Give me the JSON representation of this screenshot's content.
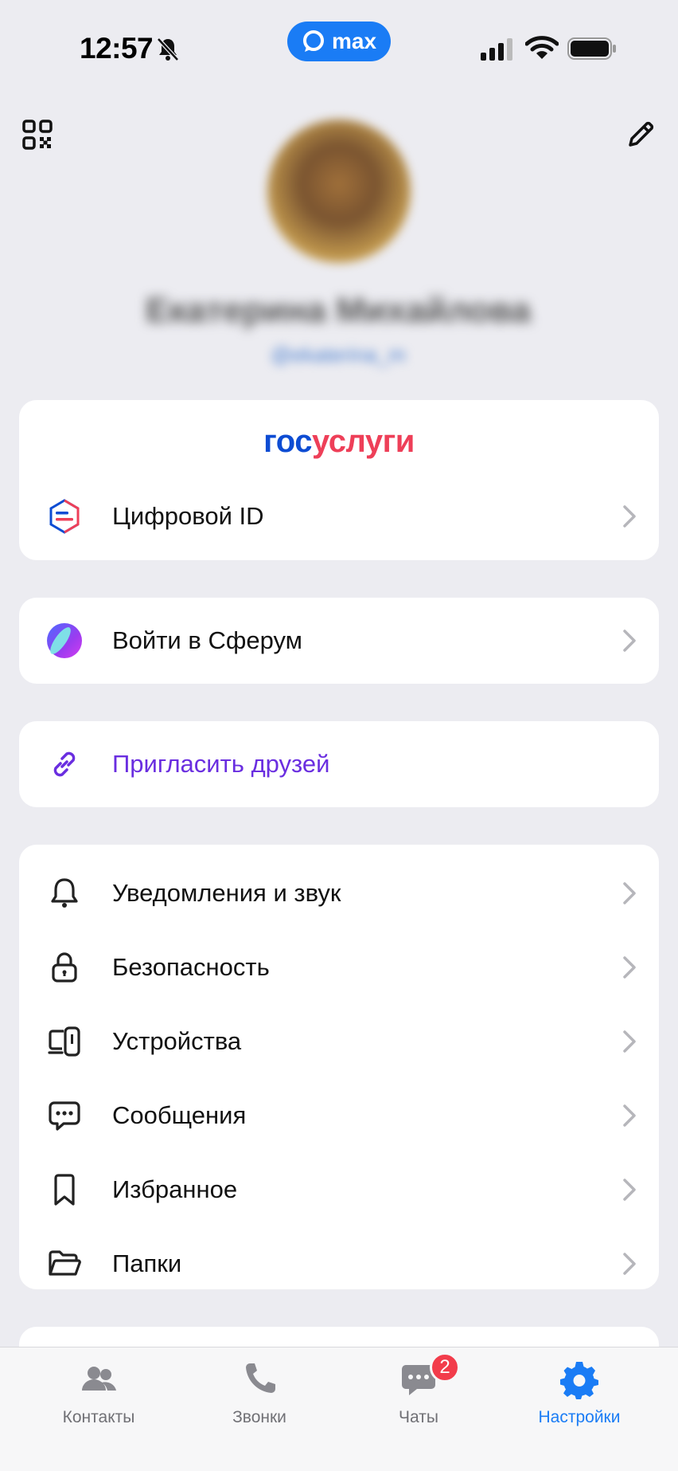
{
  "status_bar": {
    "time": "12:57",
    "app_pill": "max"
  },
  "profile": {
    "name": "Екатерина Михайлова",
    "username": "@ekaterina_m"
  },
  "gosuslugi": {
    "logo_part1": "гос",
    "logo_part2": "услуги",
    "item_label": "Цифровой ID"
  },
  "sferum": {
    "label": "Войти в Сферум"
  },
  "invite": {
    "label": "Пригласить друзей",
    "color": "#6a2ee0"
  },
  "settings_items": [
    {
      "label": "Уведомления и звук",
      "icon": "bell-icon"
    },
    {
      "label": "Безопасность",
      "icon": "lock-icon"
    },
    {
      "label": "Устройства",
      "icon": "devices-icon"
    },
    {
      "label": "Сообщения",
      "icon": "message-icon"
    },
    {
      "label": "Избранное",
      "icon": "bookmark-icon"
    },
    {
      "label": "Папки",
      "icon": "folder-icon"
    }
  ],
  "tabs": [
    {
      "label": "Контакты",
      "icon": "contacts-icon"
    },
    {
      "label": "Звонки",
      "icon": "phone-icon"
    },
    {
      "label": "Чаты",
      "icon": "chat-icon",
      "badge": "2"
    },
    {
      "label": "Настройки",
      "icon": "gear-icon",
      "active": true
    }
  ],
  "colors": {
    "accent": "#1a7cf5",
    "background": "#ececf1",
    "badge": "#f23c4b"
  }
}
